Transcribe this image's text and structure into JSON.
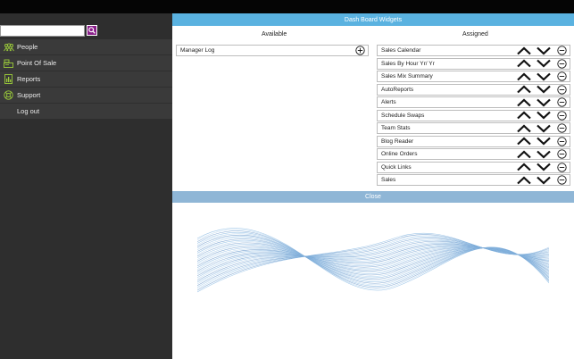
{
  "search": {
    "placeholder": "",
    "value": ""
  },
  "sidebar": {
    "items": [
      {
        "label": "People",
        "icon": "people-icon"
      },
      {
        "label": "Point Of Sale",
        "icon": "register-icon"
      },
      {
        "label": "Reports",
        "icon": "report-icon"
      },
      {
        "label": "Support",
        "icon": "support-icon"
      },
      {
        "label": "Log out",
        "icon": ""
      }
    ]
  },
  "widgets": {
    "title": "Dash Board Widgets",
    "available_label": "Available",
    "assigned_label": "Assigned",
    "available": [
      "Manager Log"
    ],
    "assigned": [
      "Sales Calendar",
      "Sales By Hour Yr/ Yr",
      "Sales Mix Summary",
      "AutoReports",
      "Alerts",
      "Schedule Swaps",
      "Team Stats",
      "Blog Reader",
      "Online Orders",
      "Quick Links",
      "Sales"
    ],
    "close_label": "Close"
  },
  "colors": {
    "accent": "#5ab2e0",
    "close_bar": "#8fb6d6",
    "search_button": "#8a1f8a",
    "sidebar": "#2e2e2e",
    "icon_green": "#9ccc3a"
  }
}
